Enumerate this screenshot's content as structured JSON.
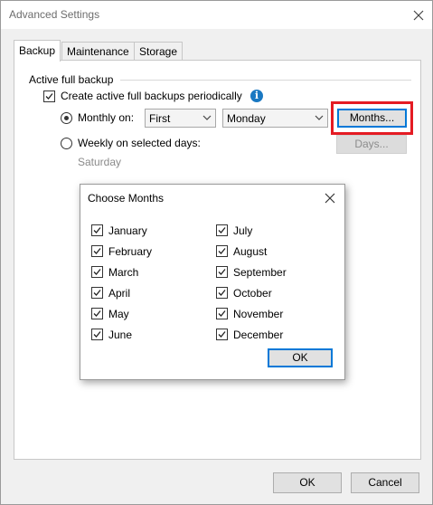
{
  "window": {
    "title": "Advanced Settings"
  },
  "tabs": [
    {
      "label": "Backup",
      "active": true
    },
    {
      "label": "Maintenance",
      "active": false
    },
    {
      "label": "Storage",
      "active": false
    }
  ],
  "backup": {
    "group_label": "Active full backup",
    "periodic_checkbox_label": "Create active full backups periodically",
    "periodic_checked": true,
    "monthly_label": "Monthly on:",
    "monthly_selected": true,
    "week_select_value": "First",
    "day_select_value": "Monday",
    "months_button_label": "Months...",
    "weekly_label": "Weekly on selected days:",
    "weekly_selected": false,
    "weekly_days_text": "Saturday",
    "days_button_label": "Days..."
  },
  "months_dialog": {
    "title": "Choose Months",
    "months": [
      {
        "label": "January",
        "checked": true
      },
      {
        "label": "February",
        "checked": true
      },
      {
        "label": "March",
        "checked": true
      },
      {
        "label": "April",
        "checked": true
      },
      {
        "label": "May",
        "checked": true
      },
      {
        "label": "June",
        "checked": true
      },
      {
        "label": "July",
        "checked": true
      },
      {
        "label": "August",
        "checked": true
      },
      {
        "label": "September",
        "checked": true
      },
      {
        "label": "October",
        "checked": true
      },
      {
        "label": "November",
        "checked": true
      },
      {
        "label": "December",
        "checked": true
      }
    ],
    "ok_label": "OK"
  },
  "footer": {
    "ok_label": "OK",
    "cancel_label": "Cancel"
  },
  "colors": {
    "highlight": "#e41b23",
    "focus": "#0078d7",
    "info": "#1a78c2"
  }
}
